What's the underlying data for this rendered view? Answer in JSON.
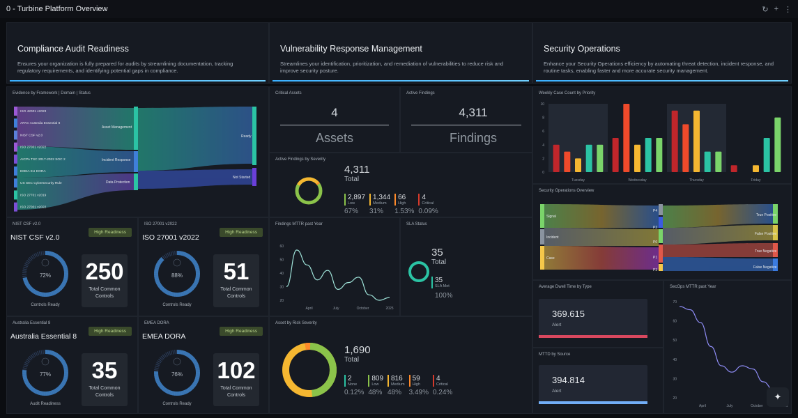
{
  "header": {
    "title": "0 - Turbine Platform Overview",
    "tools": [
      "↻",
      "+",
      "⋮"
    ]
  },
  "sections": {
    "compliance": {
      "title": "Compliance Audit Readiness",
      "desc": "Ensures your organization is fully prepared for audits by streamlining documentation, tracking regulatory requirements, and identifying potential gaps in compliance."
    },
    "vuln": {
      "title": "Vulnerability Response Management",
      "desc": "Streamlines your identification, prioritization, and remediation of vulnerabilities to reduce risk and improve security posture."
    },
    "secops": {
      "title": "Security Operations",
      "desc": "Enhance your Security Operations efficiency by automating threat detection, incident response, and routine tasks, enabling faster and more accurate security management."
    }
  },
  "evidence": {
    "title": "Evidence by Framework | Domain | Status",
    "frameworks": [
      "ISO 42001 v2023",
      "APAC Australia Essential 8",
      "NIST CSF v2.0",
      "ISO 27001 v2022",
      "AICPA TSC 2017-2022 SOC 2",
      "EMEA EU DORA",
      "US SEC Cybersecurity Rule",
      "ISO 27701 v2019",
      "ISO 27001 v2022"
    ],
    "domains": [
      "Asset Management",
      "Incident Response",
      "Data Protection"
    ],
    "statuses": [
      "Ready",
      "Not Started"
    ]
  },
  "readiness": [
    {
      "panel": "NIST CSF v2.0",
      "name": "NIST CSF v2.0",
      "badge": "High Readiness",
      "pct": "72%",
      "pct_value": 72,
      "ring_label": "Controls Ready",
      "count": "250",
      "count_label": "Total Common Controls",
      "mini": "20 40 60 80"
    },
    {
      "panel": "ISO 27001 v2022",
      "name": "ISO 27001 v2022",
      "badge": "High Readiness",
      "pct": "88%",
      "pct_value": 88,
      "ring_label": "Controls Ready",
      "count": "51",
      "count_label": "Total Common Controls",
      "mini": "20 40 60 80"
    },
    {
      "panel": "Australia Essential 8",
      "name": "Australia Essential 8",
      "badge": "High Readiness",
      "pct": "77%",
      "pct_value": 77,
      "ring_label": "Audit Readiness",
      "count": "35",
      "count_label": "Total Common Controls",
      "mini": "20 40 60 80"
    },
    {
      "panel": "EMEA DORA",
      "name": "EMEA DORA",
      "badge": "High Readiness",
      "pct": "76%",
      "pct_value": 76,
      "ring_label": "Controls Ready",
      "count": "102",
      "count_label": "Total Common Controls",
      "mini": "20 40 60 80"
    }
  ],
  "critical_assets": {
    "title": "Critical Assets",
    "value": "4",
    "label": "Assets"
  },
  "active_findings": {
    "title": "Active Findings",
    "value": "4,311",
    "label": "Findings"
  },
  "severity": {
    "title": "Active Findings by Severity",
    "total": "4,311",
    "total_label": "Total",
    "items": [
      {
        "v": "2,897",
        "k": "Low",
        "p": "67%",
        "c": "#8bc34a"
      },
      {
        "v": "1,344",
        "k": "Medium",
        "p": "31%",
        "c": "#f5b731"
      },
      {
        "v": "66",
        "k": "High",
        "p": "1.53%",
        "c": "#ff8a2a"
      },
      {
        "v": "4",
        "k": "Critical",
        "p": "0.09%",
        "c": "#d63a2b"
      }
    ]
  },
  "mttr": {
    "title": "Findings MTTR past Year",
    "yticks": [
      "60",
      "50",
      "40",
      "30",
      "20"
    ],
    "xticks": [
      "April",
      "July",
      "October",
      "2025"
    ]
  },
  "sla": {
    "title": "SLA Status",
    "total": "35",
    "total_label": "Total",
    "met": "35",
    "met_label": "SLA Met",
    "met_pct": "100%",
    "color": "#2bc3a4"
  },
  "risk": {
    "title": "Asset by Risk Severity",
    "total": "1,690",
    "total_label": "Total",
    "items": [
      {
        "v": "2",
        "k": "None",
        "p": "0.12%",
        "c": "#2bc3a4"
      },
      {
        "v": "809",
        "k": "Low",
        "p": "48%",
        "c": "#8bc34a"
      },
      {
        "v": "816",
        "k": "Medium",
        "p": "48%",
        "c": "#f5b731"
      },
      {
        "v": "59",
        "k": "High",
        "p": "3.49%",
        "c": "#ff8a2a"
      },
      {
        "v": "4",
        "k": "Critical",
        "p": "0.24%",
        "c": "#d63a2b"
      }
    ]
  },
  "weekly": {
    "title": "Weekly Case Count by Priority",
    "yticks": [
      "10",
      "8",
      "6",
      "4",
      "2",
      "0"
    ],
    "days": [
      "Tuesday",
      "Wednesday",
      "Thursday",
      "Friday"
    ]
  },
  "secops_overview": {
    "title": "Security Operations Overview",
    "left": [
      "Signal",
      "Incident",
      "Case"
    ],
    "mid": [
      "P4",
      "P2",
      "P0",
      "P1",
      "P3"
    ],
    "right": [
      "True Positive",
      "False Positive",
      "True Negative",
      "False Negative"
    ]
  },
  "dwell": {
    "title": "Average Dwell Time by Type",
    "value": "369.615",
    "label": "Alert",
    "color": "#d9485f"
  },
  "mttd": {
    "title": "MTTD by Source",
    "value": "394.814",
    "label": "Alert",
    "color": "#72aef7"
  },
  "secops_mttr": {
    "title": "SecOps MTTR past Year",
    "yticks": [
      "70",
      "60",
      "50",
      "40",
      "30",
      "20"
    ],
    "xticks": [
      "April",
      "July",
      "October",
      "2025"
    ]
  },
  "chart_data": [
    {
      "type": "bar",
      "title": "Weekly Case Count by Priority",
      "categories": [
        "Tuesday",
        "Wednesday",
        "Thursday",
        "Friday"
      ],
      "ylim": [
        0,
        10
      ],
      "series": [
        {
          "values": [
            4,
            5,
            9,
            1
          ],
          "color": "#c0262b"
        },
        {
          "values": [
            3,
            10,
            7,
            0
          ],
          "color": "#ef4a2b"
        },
        {
          "values": [
            2,
            4,
            9,
            1
          ],
          "color": "#f5b731"
        },
        {
          "values": [
            4,
            5,
            3,
            5
          ],
          "color": "#2bc3a4"
        },
        {
          "values": [
            4,
            5,
            3,
            8
          ],
          "color": "#7ad46a"
        }
      ]
    },
    {
      "type": "line",
      "title": "Findings MTTR past Year",
      "ylim": [
        20,
        60
      ],
      "values": [
        30,
        57,
        46,
        35,
        42,
        28,
        33,
        37,
        24,
        20,
        22
      ]
    },
    {
      "type": "line",
      "title": "SecOps MTTR past Year",
      "ylim": [
        15,
        75
      ],
      "values": [
        72,
        70,
        62,
        47,
        35,
        31,
        35,
        33,
        25,
        20,
        18
      ]
    }
  ]
}
